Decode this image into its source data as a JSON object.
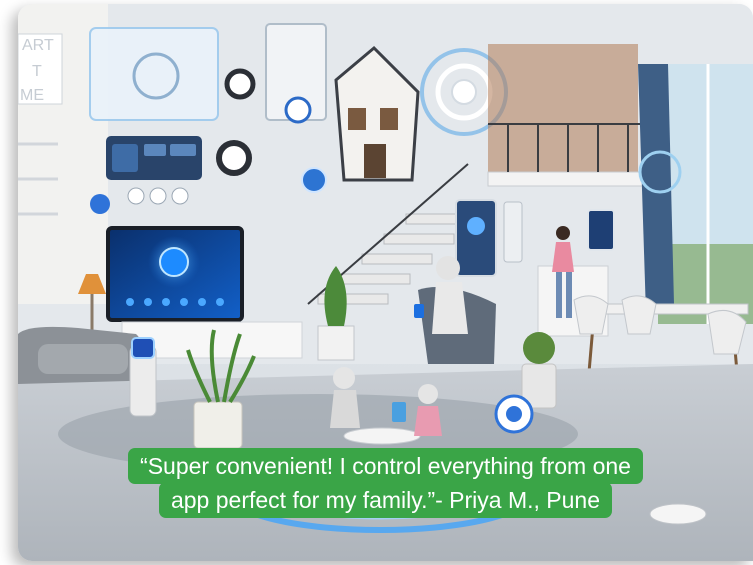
{
  "image": {
    "scene": "futuristic smart home interior",
    "sign_text": [
      "ART",
      "T",
      "ME"
    ]
  },
  "testimonial": {
    "line1": "“Super convenient! I control everything from one",
    "line2": "app perfect for my family.”- Priya M., Pune",
    "background_color": "#3aa547",
    "text_color": "#ffffff"
  }
}
